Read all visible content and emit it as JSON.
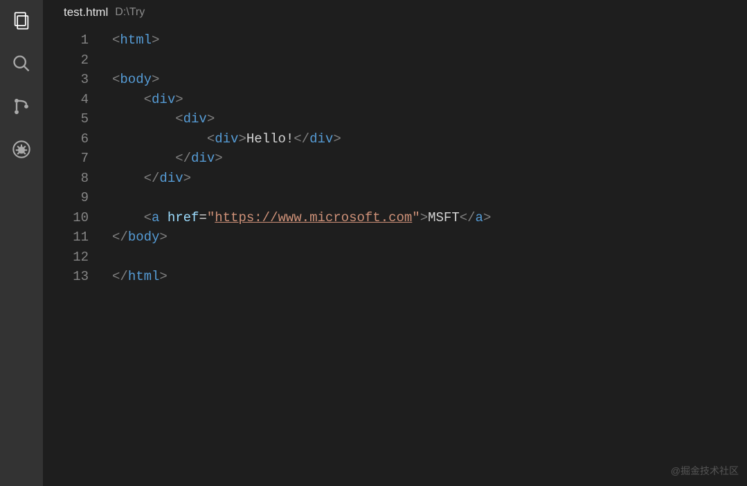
{
  "title": {
    "filename": "test.html",
    "path": "D:\\Try"
  },
  "code": {
    "lines": [
      {
        "num": "1",
        "indent": 0,
        "segments": [
          [
            "br",
            "<"
          ],
          [
            "tag",
            "html"
          ],
          [
            "br",
            ">"
          ]
        ]
      },
      {
        "num": "2",
        "indent": 0,
        "segments": []
      },
      {
        "num": "3",
        "indent": 0,
        "segments": [
          [
            "br",
            "<"
          ],
          [
            "tag",
            "body"
          ],
          [
            "br",
            ">"
          ]
        ]
      },
      {
        "num": "4",
        "indent": 1,
        "segments": [
          [
            "br",
            "<"
          ],
          [
            "tag",
            "div"
          ],
          [
            "br",
            ">"
          ]
        ]
      },
      {
        "num": "5",
        "indent": 2,
        "segments": [
          [
            "br",
            "<"
          ],
          [
            "tag",
            "div"
          ],
          [
            "br",
            ">"
          ]
        ]
      },
      {
        "num": "6",
        "indent": 3,
        "segments": [
          [
            "br",
            "<"
          ],
          [
            "tag",
            "div"
          ],
          [
            "br",
            ">"
          ],
          [
            "txt",
            "Hello!"
          ],
          [
            "br",
            "</"
          ],
          [
            "tag",
            "div"
          ],
          [
            "br",
            ">"
          ]
        ]
      },
      {
        "num": "7",
        "indent": 2,
        "segments": [
          [
            "br",
            "</"
          ],
          [
            "tag",
            "div"
          ],
          [
            "br",
            ">"
          ]
        ]
      },
      {
        "num": "8",
        "indent": 1,
        "segments": [
          [
            "br",
            "</"
          ],
          [
            "tag",
            "div"
          ],
          [
            "br",
            ">"
          ]
        ]
      },
      {
        "num": "9",
        "indent": 0,
        "segments": []
      },
      {
        "num": "10",
        "indent": 1,
        "segments": [
          [
            "br",
            "<"
          ],
          [
            "tag",
            "a"
          ],
          [
            "txt",
            " "
          ],
          [
            "attr",
            "href"
          ],
          [
            "eq",
            "="
          ],
          [
            "str",
            "\""
          ],
          [
            "url",
            "https://www.microsoft.com"
          ],
          [
            "str",
            "\""
          ],
          [
            "br",
            ">"
          ],
          [
            "txt",
            "MSFT"
          ],
          [
            "br",
            "</"
          ],
          [
            "tag",
            "a"
          ],
          [
            "br",
            ">"
          ]
        ]
      },
      {
        "num": "11",
        "indent": 0,
        "segments": [
          [
            "br",
            "</"
          ],
          [
            "tag",
            "body"
          ],
          [
            "br",
            ">"
          ]
        ]
      },
      {
        "num": "12",
        "indent": 0,
        "segments": []
      },
      {
        "num": "13",
        "indent": 0,
        "segments": [
          [
            "br",
            "</"
          ],
          [
            "tag",
            "html"
          ],
          [
            "br",
            ">"
          ]
        ]
      }
    ]
  },
  "watermark": "@掘金技术社区"
}
